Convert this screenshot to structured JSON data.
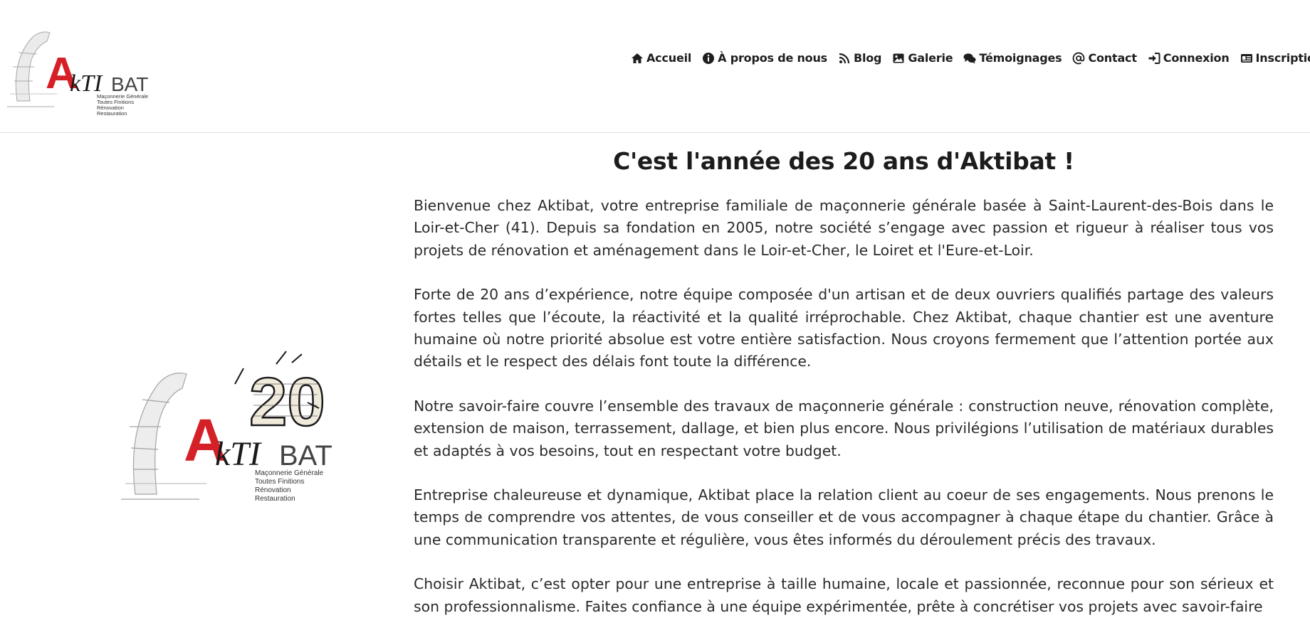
{
  "logo": {
    "letters_a": "A",
    "letters_kti": "kTI",
    "letters_bat": "BAT",
    "tagline": [
      "Maçonnerie Générale",
      "Toutes Finitions",
      "Rénovation",
      "Restauration"
    ],
    "anniversary": "20",
    "brand_red": "#d62027",
    "brand_dark": "#1a1a1a"
  },
  "nav": {
    "items": [
      {
        "label": "Accueil",
        "icon": "home-icon"
      },
      {
        "label": "À propos de nous",
        "icon": "info-circle-icon"
      },
      {
        "label": "Blog",
        "icon": "rss-icon"
      },
      {
        "label": "Galerie",
        "icon": "image-icon"
      },
      {
        "label": "Témoignages",
        "icon": "comments-icon"
      },
      {
        "label": "Contact",
        "icon": "at-icon"
      },
      {
        "label": "Connexion",
        "icon": "sign-in-icon"
      },
      {
        "label": "Inscription",
        "icon": "id-card-icon"
      }
    ]
  },
  "main": {
    "title": "C'est l'année des 20 ans d'Aktibat !",
    "paragraphs": [
      "Bienvenue chez Aktibat, votre entreprise familiale de maçonnerie générale basée à Saint-Laurent-des-Bois dans le Loir-et-Cher (41). Depuis sa fondation en 2005, notre société s’engage avec passion et rigueur à réaliser tous vos projets de rénovation et aménagement dans le Loir-et-Cher, le Loiret et l'Eure-et-Loir.",
      "Forte de 20 ans d’expérience, notre équipe composée d'un artisan et de deux ouvriers qualifiés partage des valeurs fortes telles que l’écoute, la réactivité et la qualité irréprochable. Chez Aktibat, chaque chantier est une aventure humaine où notre priorité absolue est votre entière satisfaction. Nous croyons fermement que l’attention portée aux détails et le respect des délais font toute la différence.",
      "Notre savoir-faire couvre l’ensemble des travaux de maçonnerie générale : construction neuve, rénovation complète, extension de maison, terrassement, dallage, et bien plus encore. Nous privilégions l’utilisation de matériaux durables et adaptés à vos besoins, tout en respectant votre budget.",
      "Entreprise chaleureuse et dynamique, Aktibat place la relation client au coeur de ses engagements. Nous prenons le temps de comprendre vos attentes, de vous conseiller et de vous accompagner à chaque étape du chantier. Grâce à une communication transparente et régulière, vous êtes informés du déroulement précis des travaux.",
      "Choisir Aktibat, c’est opter pour une entreprise à taille humaine, locale et passionnée, reconnue pour son sérieux et son professionnalisme. Faites confiance à une équipe expérimentée, prête à concrétiser vos projets avec savoir-faire"
    ]
  }
}
